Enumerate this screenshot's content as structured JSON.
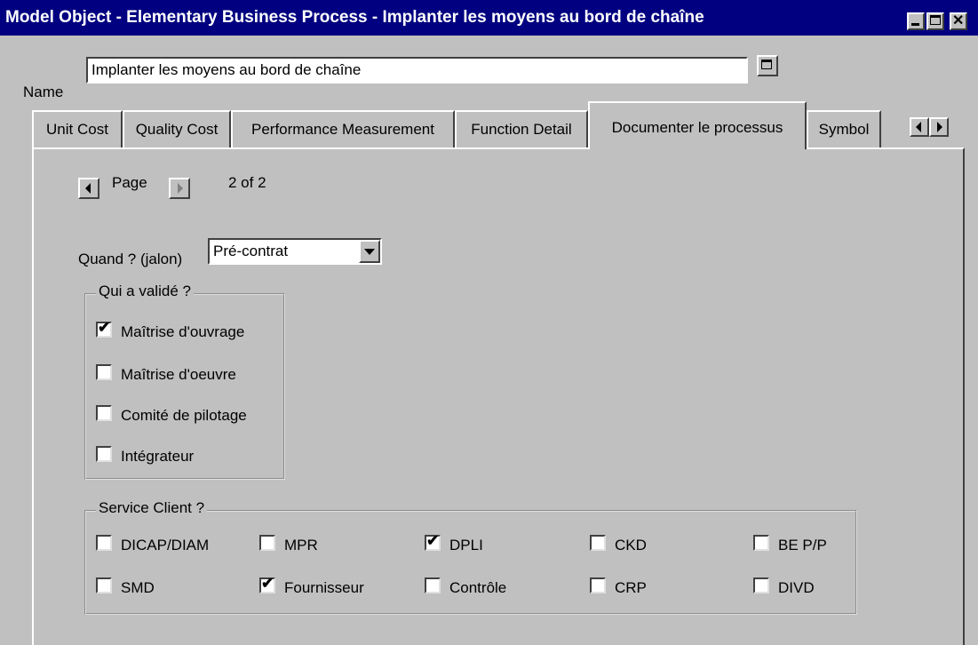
{
  "window": {
    "title": "Model Object - Elementary Business Process - Implanter les moyens au bord de chaîne"
  },
  "name_field": {
    "label": "Name",
    "value": "Implanter les moyens au bord de chaîne"
  },
  "tabs": [
    {
      "label": "Unit Cost",
      "active": false
    },
    {
      "label": "Quality Cost",
      "active": false
    },
    {
      "label": "Performance Measurement",
      "active": false
    },
    {
      "label": "Function Detail",
      "active": false
    },
    {
      "label": "Documenter le processus",
      "active": true
    },
    {
      "label": "Symbol",
      "active": false
    }
  ],
  "pager": {
    "label": "Page",
    "status": "2 of 2"
  },
  "milestone": {
    "label": "Quand ? (jalon)",
    "value": "Pré-contrat"
  },
  "validated_group": {
    "title": "Qui a validé ?",
    "items": [
      {
        "label": "Maîtrise d'ouvrage",
        "checked": true
      },
      {
        "label": "Maîtrise d'oeuvre",
        "checked": false
      },
      {
        "label": "Comité de pilotage",
        "checked": false
      },
      {
        "label": "Intégrateur",
        "checked": false
      }
    ]
  },
  "service_group": {
    "title": "Service Client ?",
    "rows": [
      [
        {
          "label": "DICAP/DIAM",
          "checked": false
        },
        {
          "label": "MPR",
          "checked": false
        },
        {
          "label": "DPLI",
          "checked": true
        },
        {
          "label": "CKD",
          "checked": false
        },
        {
          "label": "BE P/P",
          "checked": false
        }
      ],
      [
        {
          "label": "SMD",
          "checked": false
        },
        {
          "label": "Fournisseur",
          "checked": true
        },
        {
          "label": "Contrôle",
          "checked": false
        },
        {
          "label": "CRP",
          "checked": false
        },
        {
          "label": "DIVD",
          "checked": false
        }
      ]
    ]
  },
  "check_glyph": "✔",
  "colors": {
    "title_bg": "#000080",
    "face": "#c0c0c0"
  }
}
